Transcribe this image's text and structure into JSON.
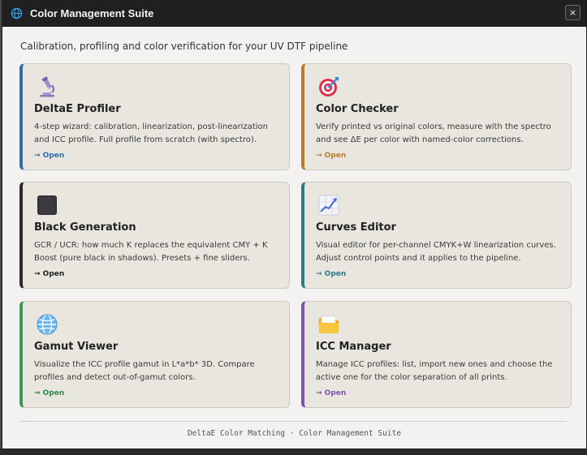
{
  "window": {
    "title": "Color Management Suite",
    "close_label": "×"
  },
  "subtitle": "Calibration, profiling and color verification for your UV DTF pipeline",
  "cards": [
    {
      "icon": "microscope-icon",
      "name": "DeltaE Profiler",
      "desc": "4-step wizard: calibration, linearization, post-linearization and ICC profile. Full profile from scratch (with spectro).",
      "open": "→ Open",
      "accent": "#2f6ea6"
    },
    {
      "icon": "target-icon",
      "name": "Color Checker",
      "desc": "Verify printed vs original colors, measure with the spectro and see ΔE per color with named-color corrections.",
      "open": "→ Open",
      "accent": "#b87a2e"
    },
    {
      "icon": "black-square-icon",
      "name": "Black Generation",
      "desc": "GCR / UCR: how much K replaces the equivalent CMY + K Boost (pure black in shadows). Presets + fine sliders.",
      "open": "→ Open",
      "accent": "#2a2a2a"
    },
    {
      "icon": "chart-increasing-icon",
      "name": "Curves Editor",
      "desc": "Visual editor for per-channel CMYK+W linearization curves. Adjust control points and it applies to the pipeline.",
      "open": "→ Open",
      "accent": "#2e7a88"
    },
    {
      "icon": "globe-icon",
      "name": "Gamut Viewer",
      "desc": "Visualize the ICC profile gamut in L*a*b* 3D. Compare profiles and detect out-of-gamut colors.",
      "open": "→ Open",
      "accent": "#3a9a52"
    },
    {
      "icon": "folder-icon",
      "name": "ICC Manager",
      "desc": "Manage ICC profiles: list, import new ones and choose the active one for the color separation of all prints.",
      "open": "→ Open",
      "accent": "#7d55a8"
    }
  ],
  "footer": "DeltaE Color Matching · Color Management Suite"
}
